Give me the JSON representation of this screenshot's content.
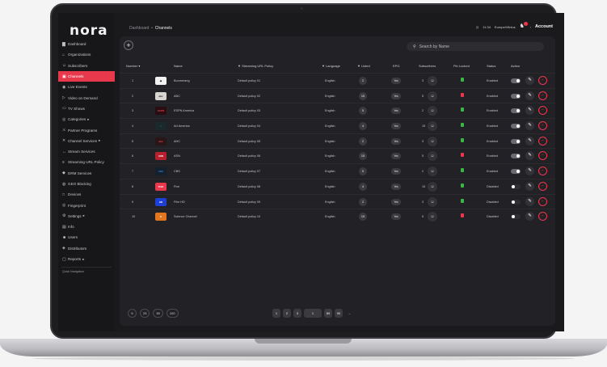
{
  "app": {
    "logo": "nora"
  },
  "breadcrumb": {
    "root": "Dashboard",
    "separator": "•",
    "current": "Channels"
  },
  "topbar": {
    "time": "11:34",
    "timezone": "Europe/Vilnius",
    "account_label": "Account",
    "notification_color": "#e8384c"
  },
  "sidebar": {
    "items": [
      {
        "label": "Dashboard",
        "icon": "grid-icon",
        "glyph": "▇"
      },
      {
        "label": "Organizations",
        "icon": "building-icon",
        "glyph": "⌂"
      },
      {
        "label": "Subscribers",
        "icon": "user-icon",
        "glyph": "☺"
      },
      {
        "label": "Channels",
        "icon": "tv-icon",
        "glyph": "▣",
        "active": true
      },
      {
        "label": "Live Events",
        "icon": "live-icon",
        "glyph": "◉"
      },
      {
        "label": "Video on Demand",
        "icon": "video-icon",
        "glyph": "▷"
      },
      {
        "label": "TV Shows",
        "icon": "tv-show-icon",
        "glyph": "▭"
      },
      {
        "label": "Categories",
        "icon": "categories-icon",
        "glyph": "◎",
        "chevron": "▸"
      },
      {
        "label": "Partner Programs",
        "icon": "handshake-icon",
        "glyph": "⚔"
      },
      {
        "label": "Channel Services",
        "icon": "services-icon",
        "glyph": "✕",
        "chevron": "▸"
      },
      {
        "label": "Stream Services",
        "icon": "stream-icon",
        "glyph": "↔"
      },
      {
        "label": "Streaming URL Policy",
        "icon": "policy-icon",
        "glyph": "≡"
      },
      {
        "label": "DRM Services",
        "icon": "shield-icon",
        "glyph": "◆"
      },
      {
        "label": "GEO Blocking",
        "icon": "globe-icon",
        "glyph": "◍"
      },
      {
        "label": "Devices",
        "icon": "device-icon",
        "glyph": "□"
      },
      {
        "label": "Fingerprint",
        "icon": "fingerprint-icon",
        "glyph": "◎"
      },
      {
        "label": "Settings",
        "icon": "gear-icon",
        "glyph": "⚙",
        "chevron": "▸"
      },
      {
        "label": "Info",
        "icon": "info-icon",
        "glyph": "▤"
      },
      {
        "label": "Users",
        "icon": "users-icon",
        "glyph": "☻"
      },
      {
        "label": "Distributors",
        "icon": "distributor-icon",
        "glyph": "◈"
      },
      {
        "label": "Reports",
        "icon": "report-icon",
        "glyph": "▢",
        "chevron": "▸"
      }
    ],
    "quick_nav": "Quick Navigation",
    "active_color": "#e8384c"
  },
  "toolbar": {
    "add_label": "+",
    "search_placeholder": "Search by Name"
  },
  "table": {
    "headers": {
      "number": "Number ▾",
      "name": "Name",
      "policy": "▼ Streaming URL Policy",
      "language": "▼ Language",
      "listed": "▼ Listed",
      "epg": "EPG",
      "subscribers": "Subscribers",
      "pin_locked": "Pin Locked",
      "status": "Status",
      "action": "Action"
    },
    "rows": [
      {
        "num": "1",
        "name": "Boomerang",
        "policy": "Default policy 01",
        "language": "English",
        "listed": "2",
        "epg": "Yes",
        "subs": "3",
        "pin": "unlocked",
        "status": "Enabled",
        "toggle": "on",
        "logo": "◆",
        "logo_bg": "#f2f2f2",
        "logo_fg": "#111"
      },
      {
        "num": "2",
        "name": "ABC",
        "policy": "Default policy 02",
        "language": "English",
        "listed": "15",
        "epg": "Yes",
        "subs": "5",
        "pin": "locked",
        "status": "Enabled",
        "toggle": "on",
        "logo": "abc",
        "logo_bg": "#d8d4cf",
        "logo_fg": "#222"
      },
      {
        "num": "3",
        "name": "ESPN America",
        "policy": "Default policy 03",
        "language": "English",
        "listed": "5",
        "epg": "Yes",
        "subs": "2",
        "pin": "unlocked",
        "status": "Enabled",
        "toggle": "on",
        "logo": "ESPN",
        "logo_bg": "#2a0d10",
        "logo_fg": "#e8384c"
      },
      {
        "num": "4",
        "name": "Art America",
        "policy": "Default policy 04",
        "language": "English",
        "listed": "4",
        "epg": "Yes",
        "subs": "15",
        "pin": "unlocked",
        "status": "Enabled",
        "toggle": "on",
        "logo": "○",
        "logo_bg": "#1a2a2c",
        "logo_fg": "#3fd4d8"
      },
      {
        "num": "5",
        "name": "AHC",
        "policy": "Default policy 05",
        "language": "English",
        "listed": "2",
        "epg": "Yes",
        "subs": "3",
        "pin": "unlocked",
        "status": "Enabled",
        "toggle": "on",
        "logo": "ahc",
        "logo_bg": "#2a1618",
        "logo_fg": "#e04a4a"
      },
      {
        "num": "6",
        "name": "ASN",
        "policy": "Default policy 06",
        "language": "English",
        "listed": "15",
        "epg": "Yes",
        "subs": "5",
        "pin": "locked",
        "status": "Enabled",
        "toggle": "on",
        "logo": "ASN",
        "logo_bg": "#b5222e",
        "logo_fg": "#fff"
      },
      {
        "num": "7",
        "name": "CBS",
        "policy": "Default policy 07",
        "language": "English",
        "listed": "5",
        "epg": "Yes",
        "subs": "2",
        "pin": "unlocked",
        "status": "Enabled",
        "toggle": "on",
        "logo": "CBS",
        "logo_bg": "#14202e",
        "logo_fg": "#3b78c4"
      },
      {
        "num": "8",
        "name": "Five",
        "policy": "Default policy 08",
        "language": "English",
        "listed": "4",
        "epg": "Yes",
        "subs": "15",
        "pin": "unlocked",
        "status": "Disabled",
        "toggle": "off",
        "logo": "FIVE",
        "logo_bg": "#e8384c",
        "logo_fg": "#fff"
      },
      {
        "num": "9",
        "name": "Film HD",
        "policy": "Default policy 09",
        "language": "English",
        "listed": "2",
        "epg": "Yes",
        "subs": "3",
        "pin": "unlocked",
        "status": "Disabled",
        "toggle": "off",
        "logo": "HD",
        "logo_bg": "#1d3fd6",
        "logo_fg": "#fff"
      },
      {
        "num": "10",
        "name": "Science Channel",
        "policy": "Default policy 10",
        "language": "English",
        "listed": "15",
        "epg": "Yes",
        "subs": "5",
        "pin": "locked",
        "status": "Disabled",
        "toggle": "off",
        "logo": "S",
        "logo_bg": "#e2761f",
        "logo_fg": "#fff"
      }
    ],
    "lock_colors": {
      "unlocked": "#3bb54a",
      "locked": "#e8384c"
    }
  },
  "footer": {
    "page_sizes": [
      "5",
      "25",
      "50",
      "100"
    ],
    "pagination": [
      "1",
      "2",
      "3",
      "1",
      "89",
      "90",
      "→"
    ]
  }
}
